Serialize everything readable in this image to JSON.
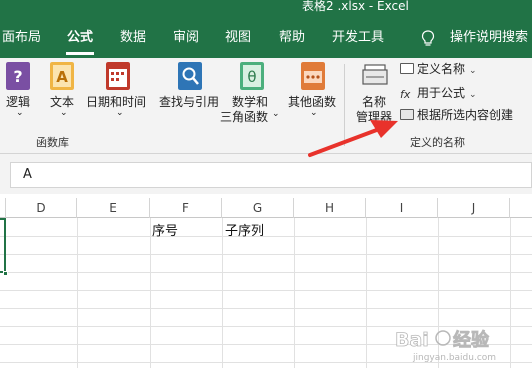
{
  "window": {
    "title": "表格2 .xlsx  -  Excel"
  },
  "tabs": [
    {
      "label": "面布局",
      "active": false
    },
    {
      "label": "公式",
      "active": true
    },
    {
      "label": "数据",
      "active": false
    },
    {
      "label": "审阅",
      "active": false
    },
    {
      "label": "视图",
      "active": false
    },
    {
      "label": "帮助",
      "active": false
    },
    {
      "label": "开发工具",
      "active": false
    }
  ],
  "tell_me": {
    "label": "操作说明搜索"
  },
  "ribbon": {
    "function_library": {
      "group_label": "函数库",
      "buttons": [
        {
          "label": "逻辑",
          "has_dropdown": true,
          "icon": "logical-function-icon",
          "icon_color": "#7a4fa3"
        },
        {
          "label": "文本",
          "has_dropdown": true,
          "icon": "text-function-icon",
          "icon_color": "#e8a33a"
        },
        {
          "label": "日期和时间",
          "has_dropdown": true,
          "icon": "date-time-function-icon",
          "icon_color": "#c0392b"
        },
        {
          "label": "查找与引用",
          "has_dropdown": true,
          "icon": "lookup-reference-icon",
          "icon_color": "#2e75b6"
        },
        {
          "label_line1": "数学和",
          "label_line2": "三角函数",
          "has_dropdown": true,
          "icon": "math-trig-icon",
          "icon_color": "#4caf7d"
        },
        {
          "label": "其他函数",
          "has_dropdown": true,
          "icon": "more-functions-icon",
          "icon_color": "#e07b39"
        }
      ]
    },
    "defined_names": {
      "group_label": "定义的名称",
      "name_manager": {
        "label_line1": "名称",
        "label_line2": "管理器",
        "icon": "name-manager-icon"
      },
      "define_name": {
        "label": "定义名称",
        "icon": "define-name-icon"
      },
      "use_in_formula": {
        "label": "用于公式",
        "icon": "use-in-formula-icon"
      },
      "create_from_selection": {
        "label": "根据所选内容创建",
        "icon": "create-from-selection-icon"
      }
    }
  },
  "formula_bar": {
    "value": "A"
  },
  "columns": [
    "D",
    "E",
    "F",
    "G",
    "H",
    "I",
    "J"
  ],
  "cells": [
    {
      "col": "F",
      "row": 1,
      "value": "序号"
    },
    {
      "col": "G",
      "row": 1,
      "value": "子序列"
    }
  ],
  "watermark": {
    "text": "Baidu经验",
    "subtext": "jingyan.baidu.com"
  },
  "colors": {
    "excel_green": "#217346",
    "ribbon_bg": "#f3f3f3",
    "arrow_red": "#e8322b"
  }
}
